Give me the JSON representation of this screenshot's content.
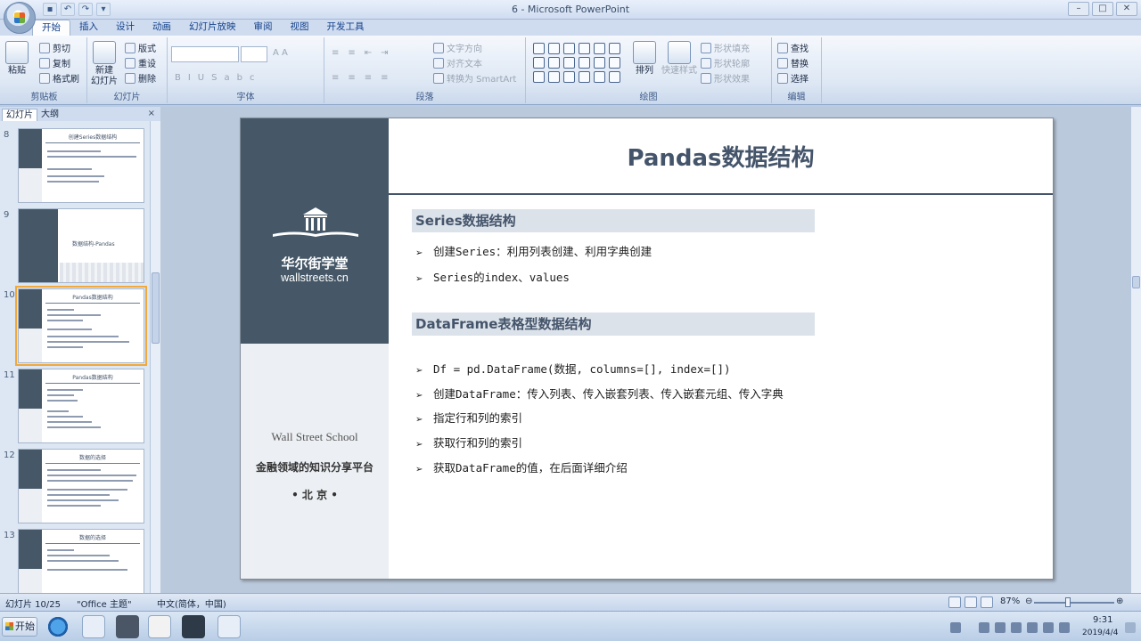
{
  "window": {
    "title": "6 - Microsoft PowerPoint"
  },
  "ribbon": {
    "tabs": [
      "开始",
      "插入",
      "设计",
      "动画",
      "幻灯片放映",
      "审阅",
      "视图",
      "开发工具"
    ],
    "clipboard": {
      "paste": "粘贴",
      "cut": "剪切",
      "copy": "复制",
      "format_painter": "格式刷",
      "label": "剪贴板"
    },
    "slides": {
      "new_slide": "新建",
      "new_slide2": "幻灯片",
      "layout": "版式",
      "reset": "重设",
      "delete": "删除",
      "label": "幻灯片"
    },
    "font": {
      "label": "字体"
    },
    "paragraph": {
      "text_direction": "文字方向",
      "align_text": "对齐文本",
      "smartart": "转换为 SmartArt",
      "label": "段落"
    },
    "drawing": {
      "arrange": "排列",
      "quick_styles": "快速样式",
      "shape_fill": "形状填充",
      "shape_outline": "形状轮廓",
      "shape_effects": "形状效果",
      "label": "绘图"
    },
    "editing": {
      "find": "查找",
      "replace": "替换",
      "select": "选择",
      "label": "编辑"
    }
  },
  "panes": {
    "tab_slides": "幻灯片",
    "tab_outline": "大纲",
    "close": "×"
  },
  "thumbnails": [
    {
      "num": "8",
      "title": "创建Series数据结构"
    },
    {
      "num": "9",
      "title": "数据结构-Pandas"
    },
    {
      "num": "10",
      "title": "Pandas数据结构"
    },
    {
      "num": "11",
      "title": "Pandas数据结构"
    },
    {
      "num": "12",
      "title": "数据的选择"
    },
    {
      "num": "13",
      "title": "数据的选择"
    }
  ],
  "slide": {
    "brand_cn": "华尔街学堂",
    "brand_url": "wallstreets.cn",
    "school_en": "Wall Street School",
    "school_cn": "金融领域的知识分享平台",
    "school_city": "• 北 京 •",
    "title": "Pandas数据结构",
    "section1": "Series数据结构",
    "section1_bullets": [
      "创建Series：利用列表创建、利用字典创建",
      "Series的index、values"
    ],
    "section2": "DataFrame表格型数据结构",
    "section2_bullets": [
      "Df = pd.DataFrame(数据, columns=[], index=[])",
      "创建DataFrame：传入列表、传入嵌套列表、传入嵌套元组、传入字典",
      "指定行和列的索引",
      "获取行和列的索引",
      "获取DataFrame的值，在后面详细介绍"
    ],
    "bullet_glyph": "➢"
  },
  "status": {
    "slide_pos": "幻灯片 10/25",
    "theme": "\"Office 主题\"",
    "language": "中文(简体，中国)",
    "zoom": "87%"
  },
  "taskbar": {
    "start": "开始",
    "time": "9:31",
    "date": "2019/4/4"
  },
  "colors": {
    "slate": "#465868",
    "title_text": "#44546a",
    "section_bg": "#dce2ea"
  }
}
